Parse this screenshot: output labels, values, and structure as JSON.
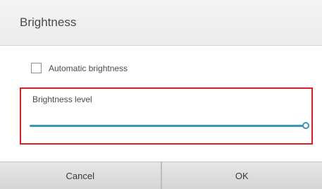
{
  "dialog": {
    "title": "Brightness",
    "automatic": {
      "label": "Automatic brightness",
      "checked": false
    },
    "level": {
      "label": "Brightness level",
      "value_fraction": 1.0
    },
    "buttons": {
      "cancel_label": "Cancel",
      "ok_label": "OK"
    }
  },
  "colors": {
    "slider_accent": "#3b95b8",
    "highlight_border": "#e02020"
  }
}
